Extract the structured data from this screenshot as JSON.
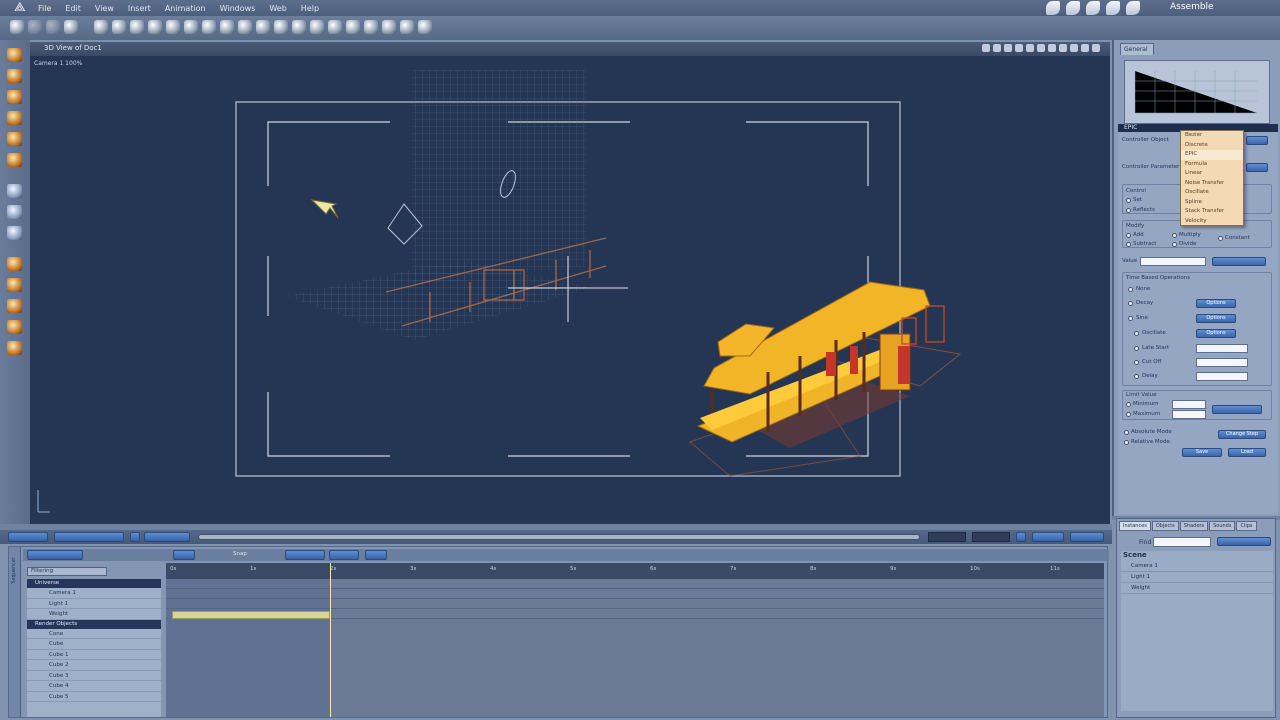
{
  "menubar": {
    "items": [
      "File",
      "Edit",
      "View",
      "Insert",
      "Animation",
      "Windows",
      "Web",
      "Help"
    ],
    "mode_label": "Assemble"
  },
  "viewport": {
    "title": "3D View of Doc1",
    "camera_label": "Camera 1 100%"
  },
  "right_panel": {
    "tab_general": "General",
    "epic_header": "EPIC",
    "labels": {
      "controller_object": "Controller Object",
      "controller_parameter": "Controller Parameter",
      "control": "Control",
      "set": "Set",
      "reflects": "Reflects",
      "modify": "Modify",
      "add": "Add",
      "subtract": "Subtract",
      "multiply": "Multiply",
      "divide": "Divide",
      "constant": "Constant",
      "value": "Value",
      "time_based_ops": "Time Based Operations",
      "none": "None",
      "decay": "Decay",
      "sine": "Sine",
      "oscillate": "Oscillate",
      "late_start": "Late Start",
      "cut_off": "Cut Off",
      "delay": "Delay",
      "limit_value": "Limit Value",
      "minimum": "Minimum",
      "maximum": "Maximum",
      "absolute_mode": "Absolute Mode",
      "relative_mode": "Relative Mode"
    },
    "buttons": {
      "options1": "Options",
      "options2": "Options",
      "options3": "Options",
      "change_step": "Change Step",
      "save": "Save",
      "load": "Load"
    },
    "dropdown_options": [
      "Bezier",
      "Discrete",
      "EPIC",
      "Formula",
      "Linear",
      "Noise Transfer",
      "Oscillate",
      "Spline",
      "Stack Transfer",
      "Velocity"
    ]
  },
  "timeline": {
    "vert_tab": "Sequencer",
    "filter_label": "Filtering",
    "snap_label": "Snap",
    "groups": [
      {
        "name": "Universe",
        "rows": [
          "Camera 1",
          "Light 1",
          "Weight"
        ]
      },
      {
        "name": "Render Objects",
        "rows": [
          "Cone",
          "Cube",
          "Cube 1",
          "Cube 2",
          "Cube 3",
          "Cube 4",
          "Cube 5"
        ]
      }
    ],
    "ticks": [
      "0s",
      "1s",
      "2s",
      "3s",
      "4s",
      "5s",
      "6s",
      "7s",
      "8s",
      "9s",
      "10s",
      "11s"
    ]
  },
  "bottom_right": {
    "tabs": [
      "Instances",
      "Objects",
      "Shaders",
      "Sounds",
      "Clips"
    ],
    "find_label": "Find",
    "scene_header": "Scene",
    "items": [
      "Camera 1",
      "Light 1",
      "Weight"
    ]
  }
}
